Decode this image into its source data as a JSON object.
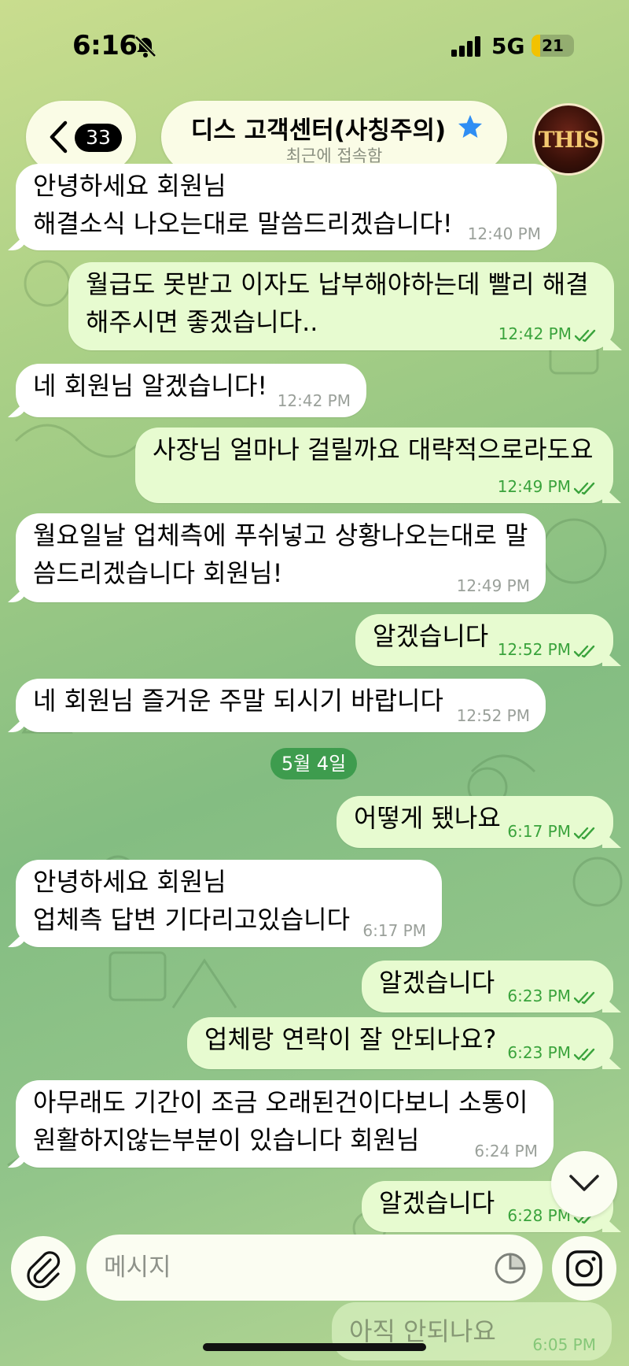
{
  "status_bar": {
    "time": "6:16",
    "network": "5G",
    "battery": "21",
    "battery_level": 0.21
  },
  "header": {
    "unread_count": "33",
    "title": "디스 고객센터(사칭주의)",
    "subtitle": "최근에 접속함",
    "avatar_label": "THIS"
  },
  "messages": [
    {
      "dir": "in",
      "lines": [
        "안녕하세요 회원님",
        "해결소식 나오는대로 말씀드리겠습니다!"
      ],
      "time": "12:40 PM"
    },
    {
      "dir": "out",
      "lines": [
        "월급도 못받고 이자도 납부해야하는데 빨리 해결",
        "해주시면 좋겠습니다.."
      ],
      "time": "12:42 PM"
    },
    {
      "dir": "in",
      "lines": [
        "네 회원님 알겠습니다!"
      ],
      "time": "12:42 PM"
    },
    {
      "dir": "out",
      "lines": [
        "사장님 얼마나 걸릴까요 대략적으로라도요"
      ],
      "time": "12:49 PM"
    },
    {
      "dir": "in",
      "lines": [
        "월요일날 업체측에 푸쉬넣고 상황나오는대로 말",
        "씀드리겠습니다 회원님!"
      ],
      "time": "12:49 PM"
    },
    {
      "dir": "out",
      "lines": [
        "알겠습니다"
      ],
      "time": "12:52 PM"
    },
    {
      "dir": "in",
      "lines": [
        "네 회원님 즐거운 주말 되시기 바랍니다"
      ],
      "time": "12:52 PM"
    },
    {
      "dir": "out",
      "lines": [
        "어떻게 됐나요"
      ],
      "time": "6:17 PM"
    },
    {
      "dir": "in",
      "lines": [
        "안녕하세요 회원님",
        "업체측 답변 기다리고있습니다"
      ],
      "time": "6:17 PM"
    },
    {
      "dir": "out",
      "lines": [
        "알겠습니다"
      ],
      "time": "6:23 PM"
    },
    {
      "dir": "out",
      "lines": [
        "업체랑 연락이 잘 안되나요?"
      ],
      "time": "6:23 PM"
    },
    {
      "dir": "in",
      "lines": [
        "아무래도 기간이 조금 오래된건이다보니 소통이",
        "원활하지않는부분이 있습니다 회원님"
      ],
      "time": "6:24 PM"
    },
    {
      "dir": "out",
      "lines": [
        "알겠습니다"
      ],
      "time": "6:28 PM"
    }
  ],
  "date_separator": "5월 4일",
  "composer": {
    "placeholder": "메시지"
  },
  "ghost_message": {
    "text": "아직 안되나요",
    "time": "6:05 PM"
  },
  "colors": {
    "outgoing_bubble": "#e7fbd0",
    "incoming_bubble": "#ffffff",
    "accent": "#3aa33c",
    "date_chip": "#3e9c4e",
    "star": "#2f8ef4"
  },
  "icons": [
    "bell-slash-icon",
    "signal-icon",
    "chevron-left-icon",
    "star-icon",
    "double-check-icon",
    "chevron-down-icon",
    "paperclip-icon",
    "sticker-icon",
    "instagram-icon"
  ]
}
